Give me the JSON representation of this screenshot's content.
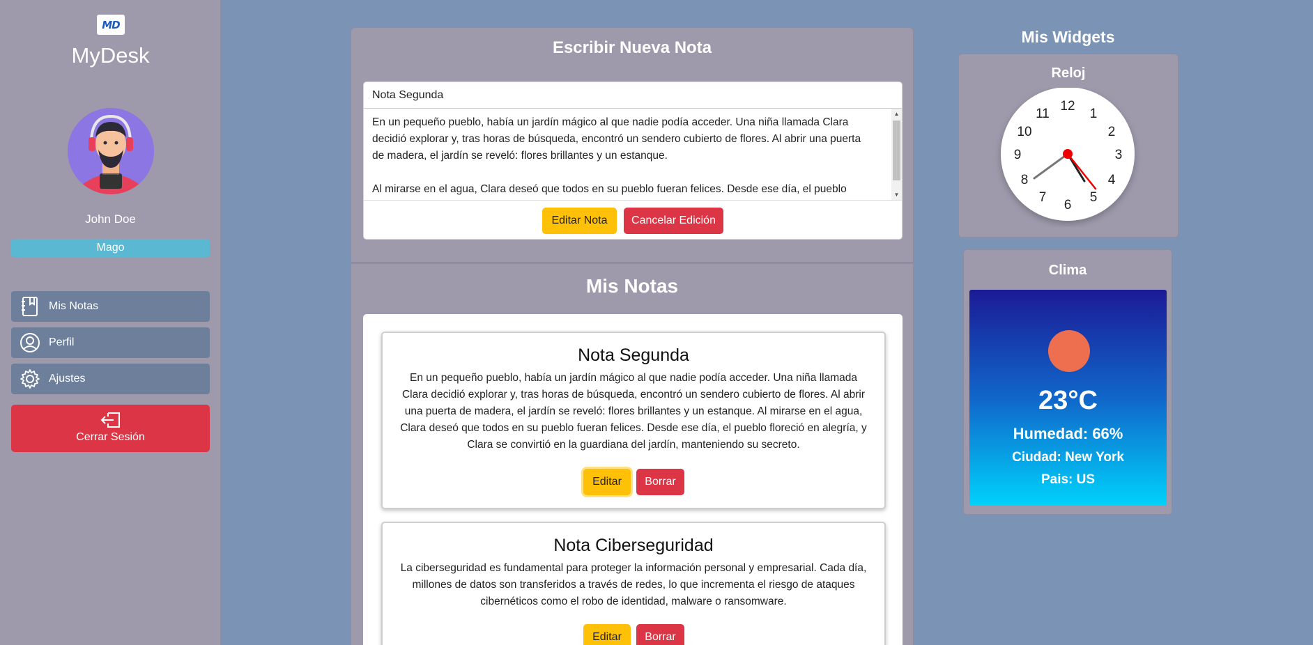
{
  "sidebar": {
    "logo_text": "MD",
    "app_title": "MyDesk",
    "user_name": "John Doe",
    "role_badge": "Mago",
    "nav": [
      {
        "label": "Mis Notas",
        "icon": "notebook-icon"
      },
      {
        "label": "Perfil",
        "icon": "user-circle-icon"
      },
      {
        "label": "Ajustes",
        "icon": "gear-icon"
      }
    ],
    "logout_label": "Cerrar Sesión",
    "logout_icon": "logout-icon"
  },
  "editor": {
    "heading": "Escribir Nueva Nota",
    "title_value": "Nota Segunda",
    "content_lines": [
      "En un pequeño pueblo, había un jardín mágico al que nadie podía acceder. Una niña llamada Clara",
      "decidió explorar y, tras horas de búsqueda, encontró un sendero cubierto de flores. Al abrir una puerta",
      "de madera, el jardín se reveló: flores brillantes y un estanque.",
      "",
      "Al mirarse en el agua, Clara deseó que todos en su pueblo fueran felices. Desde ese día, el pueblo"
    ],
    "edit_button": "Editar Nota",
    "cancel_button": "Cancelar Edición"
  },
  "notes": {
    "heading": "Mis Notas",
    "items": [
      {
        "title": "Nota Segunda",
        "body": "En un pequeño pueblo, había un jardín mágico al que nadie podía acceder. Una niña llamada Clara decidió explorar y, tras horas de búsqueda, encontró un sendero cubierto de flores. Al abrir una puerta de madera, el jardín se reveló: flores brillantes y un estanque. Al mirarse en el agua, Clara deseó que todos en su pueblo fueran felices. Desde ese día, el pueblo floreció en alegría, y Clara se convirtió en la guardiana del jardín, manteniendo su secreto.",
        "edit_label": "Editar",
        "delete_label": "Borrar"
      },
      {
        "title": "Nota Ciberseguridad",
        "body": "La ciberseguridad es fundamental para proteger la información personal y empresarial. Cada día, millones de datos son transferidos a través de redes, lo que incrementa el riesgo de ataques cibernéticos como el robo de identidad, malware o ransomware.",
        "edit_label": "Editar",
        "delete_label": "Borrar"
      }
    ]
  },
  "widgets": {
    "heading": "Mis Widgets",
    "clock": {
      "title": "Reloj",
      "numbers": [
        "12",
        "1",
        "2",
        "3",
        "4",
        "5",
        "6",
        "7",
        "8",
        "9",
        "10",
        "11"
      ]
    },
    "weather": {
      "title": "Clima",
      "temperature": "23°C",
      "humidity": "Humedad: 66%",
      "city": "Ciudad: New York",
      "country": "Pais: US"
    }
  },
  "colors": {
    "page_bg": "#7b93b4",
    "panel_bg": "#9e9aac",
    "nav_bg": "#6e7f9c",
    "badge": "#5ab8d3",
    "warning": "#ffc107",
    "danger": "#dc3545",
    "sun": "#ee6f4f"
  }
}
